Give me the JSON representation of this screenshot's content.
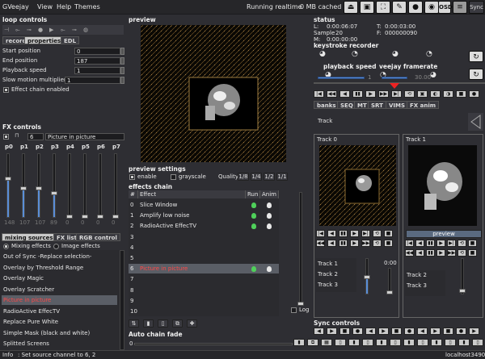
{
  "menubar": {
    "items": [
      "GVeejay",
      "View",
      "Help",
      "Themes"
    ],
    "running": "Running realtime",
    "cache": "0 MB cached",
    "osd": "OSD",
    "sync": "Sync"
  },
  "loop_controls": {
    "title": "loop controls",
    "tabs": [
      "record",
      "properties",
      "EDL"
    ],
    "fields": [
      {
        "label": "Start position",
        "value": "0"
      },
      {
        "label": "End position",
        "value": "187"
      },
      {
        "label": "Playback speed",
        "value": "1"
      },
      {
        "label": "Slow motion multiplier",
        "value": "1"
      }
    ],
    "effect_chain_enabled": "Effect chain enabled"
  },
  "fx_controls": {
    "title": "FX controls",
    "channel": "6",
    "effect_name": "Picture in picture",
    "params": [
      "p0",
      "p1",
      "p2",
      "p3",
      "p4",
      "p5",
      "p6",
      "p7"
    ],
    "param_values": [
      "148",
      "107",
      "107",
      "89",
      "0",
      "0",
      "0",
      "0"
    ],
    "param_levels": [
      0.6,
      0.45,
      0.45,
      0.37,
      0,
      0,
      0,
      0
    ]
  },
  "mixing": {
    "tabs": [
      "mixing sources",
      "FX list",
      "RGB control"
    ],
    "radio": [
      "Mixing effects",
      "Image effects"
    ],
    "effects": [
      "Out of Sync -Replace selection-",
      "Overlay by Threshold Range",
      "Overlay Magic",
      "Overlay Scratcher",
      "Picture in picture",
      "RadioActive EffecTV",
      "Replace Pure White",
      "Simple Mask (black and white)",
      "Splitted Screens"
    ],
    "selected": 4
  },
  "preview": {
    "title": "preview",
    "settings_title": "preview settings",
    "enable": "enable",
    "grayscale": "grayscale",
    "quality_label": "Quality",
    "quality": [
      "1/8",
      "1/4",
      "1/2",
      "1/1"
    ]
  },
  "effects_chain": {
    "title": "effects chain",
    "headers": [
      "#",
      "Effect",
      "Run",
      "Anim"
    ],
    "rows": [
      {
        "n": "0",
        "effect": "Slice Window",
        "run": true,
        "anim": true
      },
      {
        "n": "1",
        "effect": "Amplify low noise",
        "run": true,
        "anim": true
      },
      {
        "n": "2",
        "effect": "RadioActive EffecTV",
        "run": true,
        "anim": true
      },
      {
        "n": "3",
        "effect": "",
        "run": false,
        "anim": false
      },
      {
        "n": "4",
        "effect": "",
        "run": false,
        "anim": false
      },
      {
        "n": "5",
        "effect": "",
        "run": false,
        "anim": false
      },
      {
        "n": "6",
        "effect": "Picture in picture",
        "run": true,
        "anim": true
      },
      {
        "n": "7",
        "effect": "",
        "run": false,
        "anim": false
      },
      {
        "n": "8",
        "effect": "",
        "run": false,
        "anim": false
      },
      {
        "n": "9",
        "effect": "",
        "run": false,
        "anim": false
      },
      {
        "n": "10",
        "effect": "",
        "run": false,
        "anim": false
      }
    ],
    "selected": 6,
    "log": "Log",
    "auto_chain_fade": "Auto chain fade",
    "fade_value": "0"
  },
  "status": {
    "title": "status",
    "l": "L:",
    "l_val": "0:00:06:07",
    "t": "T:",
    "t_val": "0:00:03:00",
    "sample": "Sample",
    "sample_val": "20",
    "f": "F:",
    "f_val": "000000090",
    "m": "M:",
    "m_val": "0:00:00:00"
  },
  "keystroke": {
    "title": "keystroke recorder"
  },
  "playback": {
    "speed_title": "playback speed",
    "framerate_title": "veejay framerate",
    "speed_val": "1",
    "framerate_val": "30.00"
  },
  "right_tabs": [
    "banks",
    "SEQ",
    "MT",
    "SRT",
    "VIMS",
    "FX anim"
  ],
  "track_label": "Track",
  "tracks": {
    "track0": "Track 0",
    "track1": "Track 1",
    "preview_btn": "preview",
    "list0": [
      "Track 1",
      "Track 2",
      "Track 3"
    ],
    "list1": [
      "Track 2",
      "Track 3"
    ],
    "val": "0:00"
  },
  "sync_controls": "Sync controls",
  "statusbar": {
    "info": "Info",
    "message": ": Set source channel to 6, 2",
    "host": "localhost3490"
  }
}
